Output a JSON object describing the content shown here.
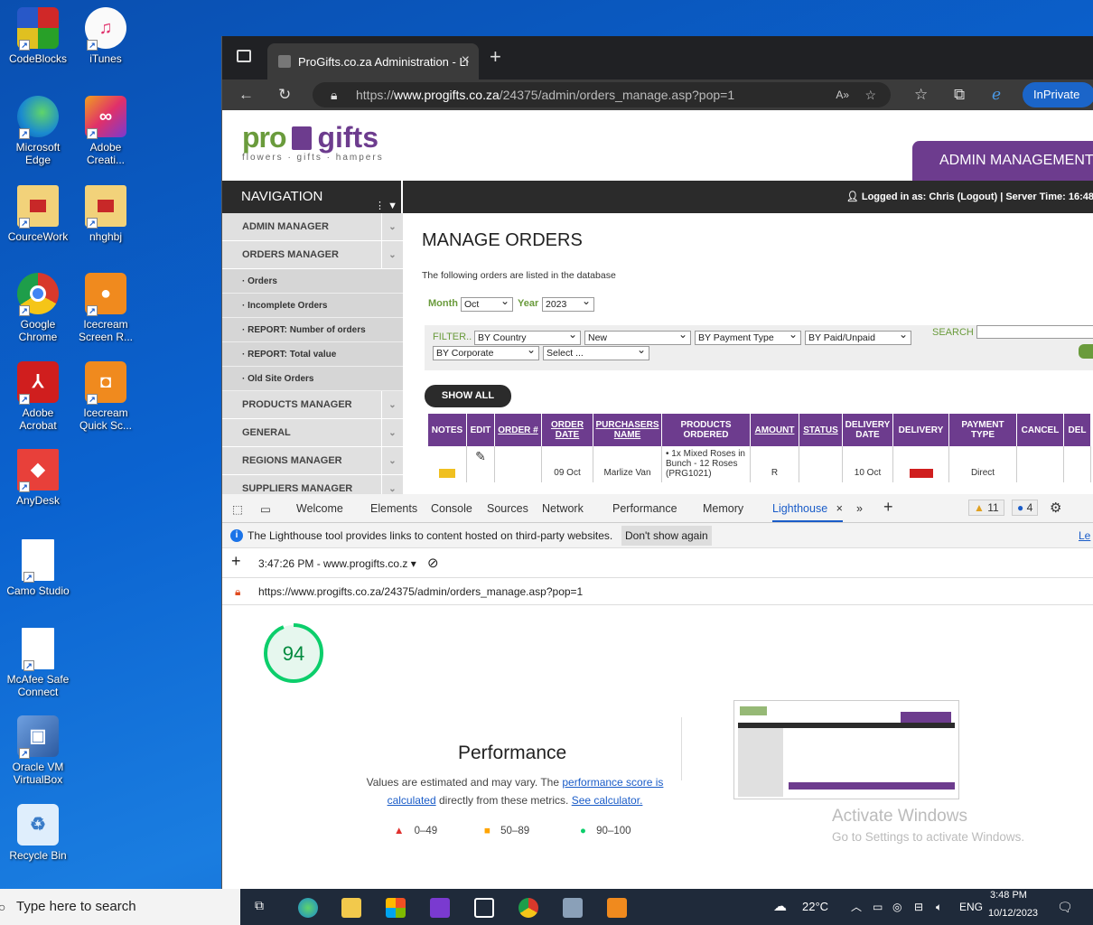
{
  "desktop": {
    "icons": [
      {
        "label": "CodeBlocks",
        "color": "#c82828"
      },
      {
        "label": "iTunes",
        "color": "#f0f0f0"
      },
      {
        "label": "Microsoft Edge",
        "color": "#1a8ad0"
      },
      {
        "label": "Adobe Creati...",
        "color": "#e0306a"
      },
      {
        "label": "CourceWork",
        "color": "#f2d27a"
      },
      {
        "label": "nhghbj",
        "color": "#f2d27a"
      },
      {
        "label": "Google Chrome",
        "color": "#ffffff"
      },
      {
        "label": "Icecream Screen R...",
        "color": "#f08a1e"
      },
      {
        "label": "Adobe Acrobat",
        "color": "#d01e1e"
      },
      {
        "label": "Icecream Quick Sc...",
        "color": "#f08a1e"
      },
      {
        "label": "AnyDesk",
        "color": "#e8403a"
      },
      {
        "label": "Camo Studio",
        "color": "#ffffff"
      },
      {
        "label": "McAfee Safe Connect",
        "color": "#ffffff"
      },
      {
        "label": "Oracle VM VirtualBox",
        "color": "#3a6ab0"
      },
      {
        "label": "Recycle Bin",
        "color": "#cfe4f8"
      }
    ],
    "activate_title": "Activate Windows",
    "activate_sub": "Go to Settings to activate Windows."
  },
  "browser": {
    "tab_title": "ProGifts.co.za Administration - Li",
    "url_prefix": "https://",
    "url_domain": "www.progifts.co.za",
    "url_path": "/24375/admin/orders_manage.asp?pop=1",
    "inprivate": "InPrivate"
  },
  "page": {
    "logo_pro": "pro",
    "logo_gifts": "gifts",
    "logo_tagline": "flowers · gifts · hampers",
    "admin_button": "ADMIN MANAGEMENT",
    "nav_title": "NAVIGATION",
    "logged_in": "Logged in as: Chris (Logout) | Server Time: 16:48",
    "sidebar": [
      {
        "label": "ADMIN MANAGER",
        "type": "section"
      },
      {
        "label": "ORDERS MANAGER",
        "type": "section"
      },
      {
        "label": "· Orders",
        "type": "sub"
      },
      {
        "label": "· Incomplete Orders",
        "type": "sub"
      },
      {
        "label": "· REPORT: Number of orders",
        "type": "sub"
      },
      {
        "label": "· REPORT: Total value",
        "type": "sub"
      },
      {
        "label": "· Old Site Orders",
        "type": "sub"
      },
      {
        "label": "PRODUCTS MANAGER",
        "type": "section"
      },
      {
        "label": "GENERAL",
        "type": "section"
      },
      {
        "label": "REGIONS MANAGER",
        "type": "section"
      },
      {
        "label": "SUPPLIERS MANAGER",
        "type": "section"
      }
    ],
    "heading": "MANAGE ORDERS",
    "subtext": "The following orders are listed in the database",
    "month_label": "Month",
    "month_value": "Oct",
    "year_label": "Year",
    "year_value": "2023",
    "filter_label": "FILTER..",
    "filters": [
      "BY Country",
      "New",
      "BY Payment Type",
      "BY Paid/Unpaid",
      "BY Corporate",
      "Select ..."
    ],
    "search_label": "SEARCH",
    "show_all": "SHOW ALL",
    "columns": [
      "NOTES",
      "EDIT",
      "ORDER #",
      "ORDER DATE",
      "PURCHASERS NAME",
      "PRODUCTS ORDERED",
      "AMOUNT",
      "STATUS",
      "DELIVERY DATE",
      "DELIVERY",
      "PAYMENT TYPE",
      "CANCEL",
      "DEL"
    ],
    "row": {
      "order_date": "09 Oct",
      "purchaser": "Marlize Van",
      "products": "• 1x Mixed Roses in Bunch - 12 Roses (PRG1021)",
      "amount": "R",
      "delivery_date": "10 Oct",
      "payment": "Direct"
    }
  },
  "devtools": {
    "tabs": [
      "Welcome",
      "Elements",
      "Console",
      "Sources",
      "Network",
      "Performance",
      "Memory",
      "Lighthouse"
    ],
    "warnings": "11",
    "messages": "4",
    "info_text": "The Lighthouse tool provides links to content hosted on third-party websites.",
    "dont_show": "Don't show again",
    "learn": "Le",
    "report_time": "3:47:26 PM - www.progifts.co.z",
    "report_url": "https://www.progifts.co.za/24375/admin/orders_manage.asp?pop=1",
    "score": "94",
    "score_fraction": 0.94,
    "category": "Performance",
    "note_1": "Values are estimated and may vary. The ",
    "note_link1": "performance score is calculated",
    "note_2": " directly from these metrics. ",
    "note_link2": "See calculator.",
    "legend": [
      "0–49",
      "50–89",
      "90–100"
    ]
  },
  "taskbar": {
    "search_placeholder": "Type here to search",
    "weather": "22°C",
    "language": "ENG",
    "time": "3:48 PM",
    "date": "10/12/2023"
  }
}
